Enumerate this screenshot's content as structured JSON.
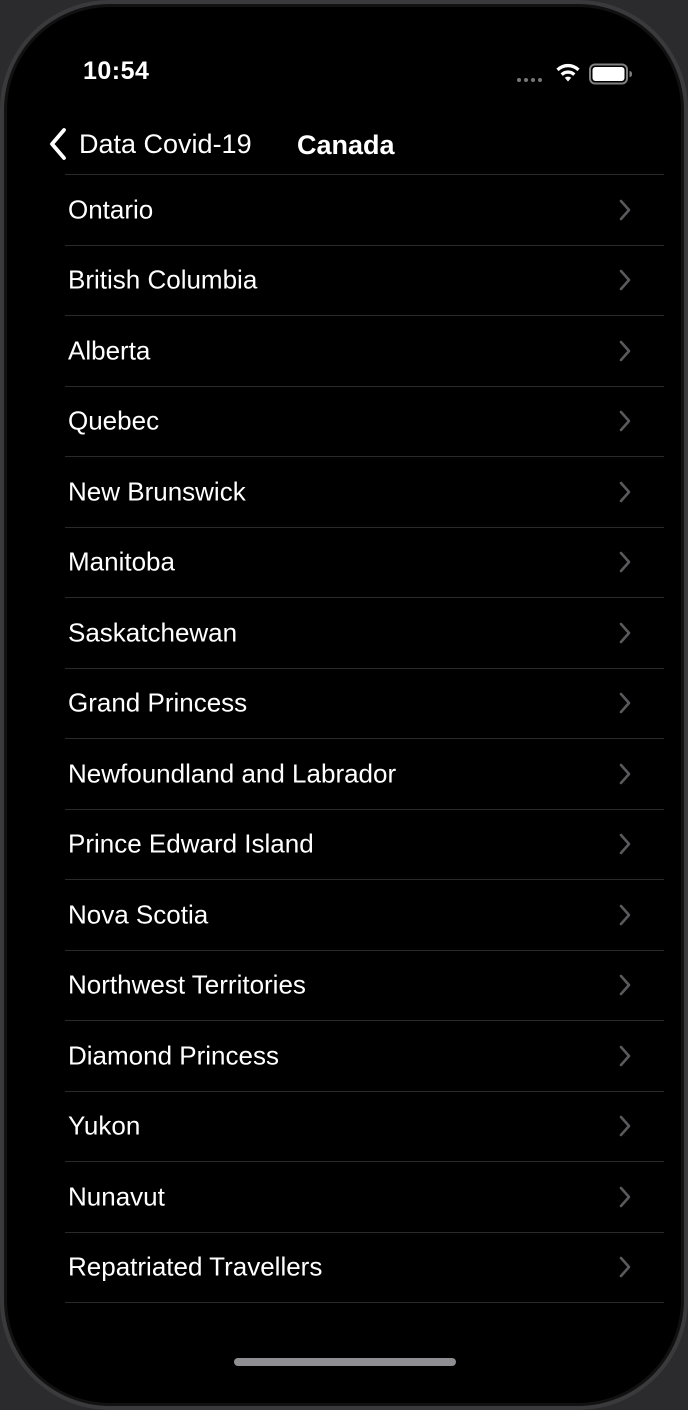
{
  "status_bar": {
    "time": "10:54",
    "icons": [
      "cellular-dots-icon",
      "wifi-icon",
      "battery-icon"
    ]
  },
  "nav": {
    "back_label": "Data Covid-19",
    "title": "Canada",
    "back_icon": "chevron-left-icon"
  },
  "provinces": [
    "Ontario",
    "British Columbia",
    "Alberta",
    "Quebec",
    "New Brunswick",
    "Manitoba",
    "Saskatchewan",
    "Grand Princess",
    "Newfoundland and Labrador",
    "Prince Edward Island",
    "Nova Scotia",
    "Northwest Territories",
    "Diamond Princess",
    "Yukon",
    "Nunavut",
    "Repatriated Travellers"
  ],
  "colors": {
    "background": "#000000",
    "text": "#ffffff",
    "separator": "#2a2a2c",
    "chevron": "#5a5a5e"
  }
}
